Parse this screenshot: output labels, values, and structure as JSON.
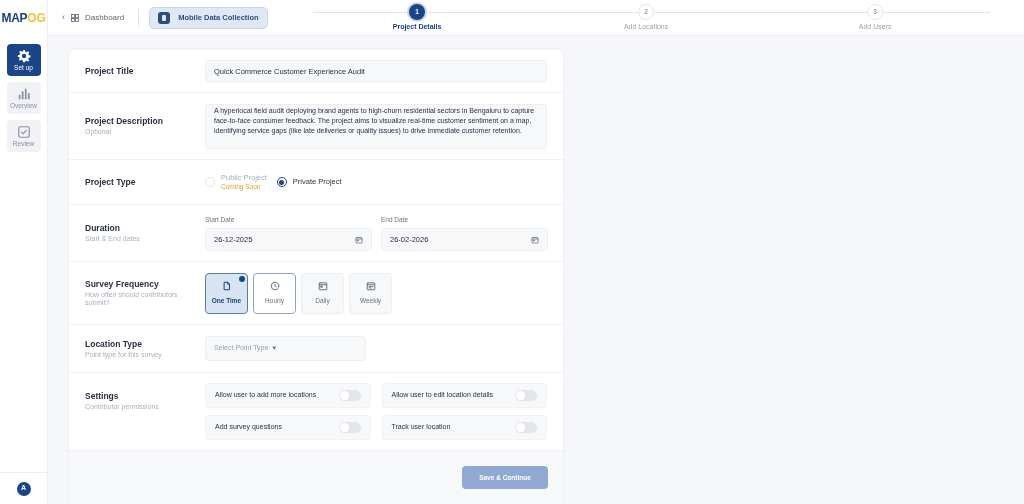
{
  "logo": {
    "part_1": "MAP",
    "part_2": "OG"
  },
  "sidebar": {
    "items": [
      {
        "label": "Set up",
        "selected": true
      },
      {
        "label": "Overview",
        "selected": false
      },
      {
        "label": "Review",
        "selected": false
      }
    ],
    "avatar": "A"
  },
  "header": {
    "back_glyph": "‹",
    "back": "Dashboard",
    "project": "Mobile Data Collection",
    "steps": [
      {
        "number": "1",
        "label": "Project Details",
        "selected": true
      },
      {
        "number": "2",
        "label": "Add Locations",
        "selected": false
      },
      {
        "number": "3",
        "label": "Add Users",
        "selected": false
      }
    ]
  },
  "form": {
    "title": {
      "label": "Project Title",
      "value": "Quick Commerce Customer Experience Audit"
    },
    "description": {
      "label": "Project Description",
      "hint": "Optional",
      "value": "A hyperlocal field audit deploying brand agents to high-churn residential sectors in Bengaluru to capture face-to-face consumer feedback. The project aims to visualize real-time customer sentiment on a map, identifying service gaps (like late deliveries or quality issues) to drive immediate customer retention."
    },
    "type": {
      "label": "Project Type",
      "options": [
        {
          "label": "Public Project",
          "note": "Coming Soon",
          "selected": false,
          "disabled": true
        },
        {
          "label": "Private Project",
          "selected": true,
          "disabled": false
        }
      ]
    },
    "duration": {
      "label": "Duration",
      "hint": "Start & End dates",
      "fields": [
        {
          "label": "Start Date",
          "value": "26-12-2025"
        },
        {
          "label": "End Date",
          "value": "26-02-2026"
        }
      ]
    },
    "frequency": {
      "label": "Survey Frequency",
      "hint": "How often should contributors submit?",
      "options": [
        {
          "label": "One Time",
          "selected": true,
          "outlined": false
        },
        {
          "label": "Hourly",
          "selected": false,
          "outlined": true
        },
        {
          "label": "Daily",
          "selected": false,
          "outlined": false
        },
        {
          "label": "Weekly",
          "selected": false,
          "outlined": false
        }
      ]
    },
    "location": {
      "label": "Location Type",
      "hint": "Point type for this survey",
      "placeholder": "Select Point Type",
      "caret": "▼"
    },
    "settings": {
      "label": "Settings",
      "hint": "Contributor permissions",
      "toggles": [
        {
          "label": "Allow user to add more locations",
          "on": false
        },
        {
          "label": "Allow user to edit location details",
          "on": false
        },
        {
          "label": "Add survey questions",
          "on": false
        },
        {
          "label": "Track user location",
          "on": false
        }
      ]
    },
    "submit": "Save & Continue"
  }
}
